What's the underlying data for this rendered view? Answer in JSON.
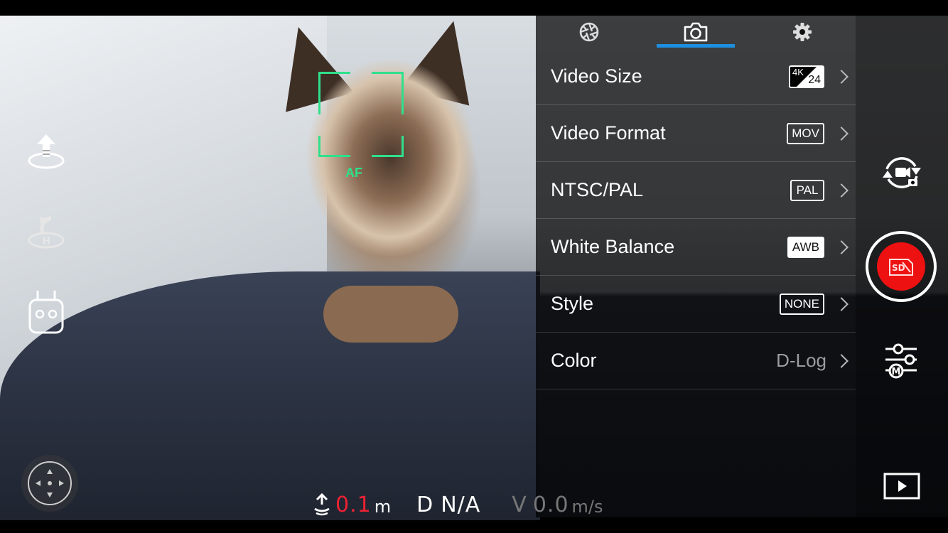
{
  "camera_tabs": [
    {
      "name": "aperture",
      "icon": "aperture-icon",
      "active": false
    },
    {
      "name": "camera",
      "icon": "camera-icon",
      "active": true
    },
    {
      "name": "settings",
      "icon": "gear-icon",
      "active": false
    }
  ],
  "focus": {
    "label": "AF",
    "color": "#2fe08c"
  },
  "menu": {
    "rows": [
      {
        "label": "Video Size",
        "badge_top": "4K",
        "badge_bottom": "24"
      },
      {
        "label": "Video Format",
        "badge": "MOV"
      },
      {
        "label": "NTSC/PAL",
        "badge": "PAL"
      },
      {
        "label": "White Balance",
        "badge": "AWB"
      },
      {
        "label": "Style",
        "badge": "NONE"
      },
      {
        "label": "Color",
        "value": "D-Log"
      }
    ]
  },
  "telemetry": {
    "height_value": "0.1",
    "height_unit": "m",
    "distance_prefix": "D",
    "distance_value": "N/A",
    "speed_prefix": "V",
    "speed_value": "0.0",
    "speed_unit": "m/s"
  },
  "left_icons": [
    "takeoff-icon",
    "return-home-icon",
    "remote-controller-icon",
    "joystick-icon"
  ],
  "right_icons": [
    "switch-photo-video-icon",
    "record-button-icon",
    "camera-settings-manual-icon",
    "playback-icon"
  ],
  "record": {
    "label": "SD"
  },
  "colors": {
    "accent": "#1e8fe0",
    "record": "#ee1111",
    "height_value": "#ee2233",
    "muted": "#9c9c9c"
  }
}
